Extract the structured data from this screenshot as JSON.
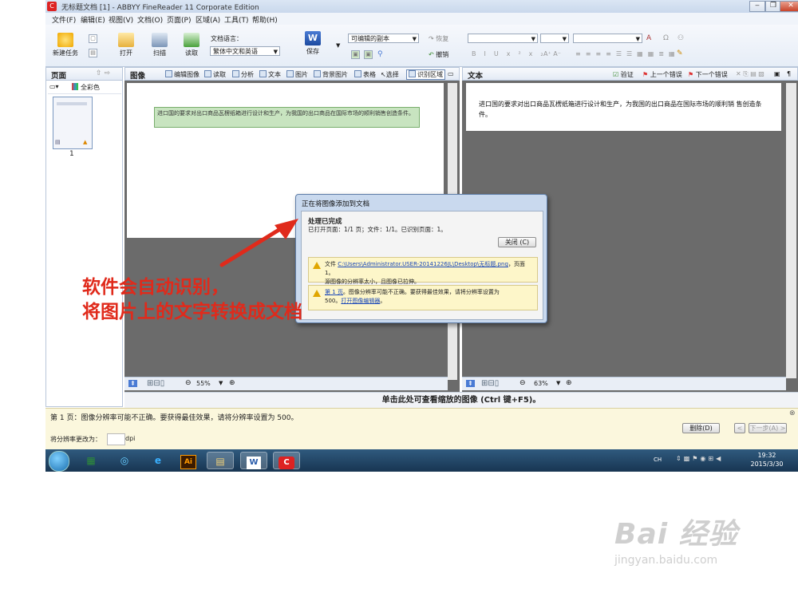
{
  "window": {
    "title": "无标题文档 [1] - ABBYY FineReader 11 Corporate Edition",
    "controls": [
      "‒",
      "❐",
      "✕"
    ]
  },
  "menu": [
    "文件(F)",
    "编辑(E)",
    "视图(V)",
    "文档(O)",
    "页面(P)",
    "区域(A)",
    "工具(T)",
    "帮助(H)"
  ],
  "toolbar": {
    "new_task": "新建任务",
    "open": "打开",
    "scan": "扫描",
    "read": "读取",
    "doc_language_label": "文档语言：",
    "doc_language_value": "繁体中文和英语",
    "save": "保存",
    "save_format": "可编辑的副本",
    "redo": "恢复",
    "undo": "撤销"
  },
  "pages_pane": {
    "title": "页面",
    "color_mode": "全彩色",
    "page_number": "1"
  },
  "image_pane": {
    "title": "图像",
    "tools": [
      "编辑图像",
      "读取",
      "分析",
      "文本",
      "图片",
      "背景图片",
      "表格",
      "选择",
      "识别区域"
    ],
    "doc_text": "进口国的要求对出口商品瓦楞纸箱进行设计和生产，为我国的出口商品在国际市场的顺利销售创造条件。",
    "zoom": "55%"
  },
  "text_pane": {
    "title": "文本",
    "verify": "验证",
    "prev_error": "上一个错误",
    "next_error": "下一个错误",
    "doc_text": "进口国的要求对出口商品瓦楞纸箱进行设计和生产，为我国的出口商品在国际市场的顺利销 售创造条件。",
    "zoom": "63%"
  },
  "hint": "单击此处可查看缩放的图像 (Ctrl 键+F5)。",
  "message_bar": {
    "text": "第 1 页：图像分辨率可能不正确。要获得最佳效果，请将分辨率设置为 500。",
    "resolution_label": "将分辨率更改为：",
    "resolution_unit": "dpi",
    "delete_button": "删除(D)",
    "prev_button": "<",
    "next_button": "下一步(A) >"
  },
  "dialog": {
    "title": "正在将图像添加到文档",
    "heading": "处理已完成",
    "summary": "已打开页面：1/1 页；文件：1/1。已识别页面：1。",
    "close_button": "关闭 (C)",
    "notice1_prefix": "文件 ",
    "notice1_link": "C:\\Users\\Administrator.USER-20141226JL\\Desktop\\无标题.png",
    "notice1_suffix": "，页面 1。",
    "notice1_line2": "源图像的分辨率太小，且图像已拉伸。",
    "notice2_link": "第 1 页",
    "notice2_text": "。图像分辨率可能不正确。要获得最佳效果，请将分辨率设置为",
    "notice2_line2": "500。",
    "notice2_link2": "打开图像编辑器",
    "notice2_end": "。"
  },
  "annotation": {
    "line1": "软件会自动识别，",
    "line2": "将图片上的文字转换成文档"
  },
  "taskbar": {
    "lang": "CH",
    "time": "19:32",
    "date": "2015/3/30"
  },
  "watermark": {
    "brand": "Bai 经验",
    "url": "jingyan.baidu.com"
  }
}
